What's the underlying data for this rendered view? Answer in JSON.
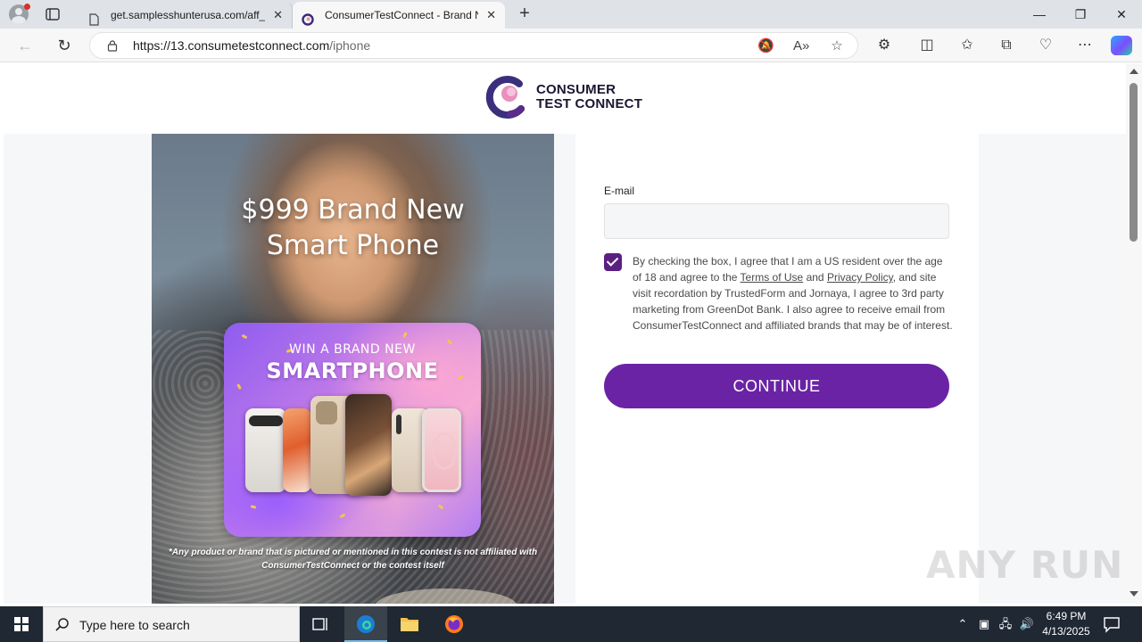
{
  "browser": {
    "tabs": [
      {
        "title": "get.samplesshunterusa.com/aff_c",
        "active": false
      },
      {
        "title": "ConsumerTestConnect - Brand N",
        "active": true
      }
    ],
    "close_glyph": "✕",
    "new_tab_glyph": "+",
    "url_host": "https://13.consumetestconnect.com",
    "url_path": "/iphone",
    "window_controls": {
      "minimize": "—",
      "restore": "❐",
      "close": "✕"
    }
  },
  "logo": {
    "line1": "CONSUMER",
    "line2": "TEST CONNECT"
  },
  "hero": {
    "title_line1": "$999 Brand New",
    "title_line2": "Smart Phone",
    "promo_line1": "WIN A BRAND NEW",
    "promo_line2": "SMARTPHONE",
    "disclaimer": "*Any product or brand that is pictured or mentioned in this contest is not affiliated with ConsumerTestConnect or the contest itself"
  },
  "form": {
    "email_label": "E-mail",
    "email_value": "",
    "checkbox_checked": true,
    "consent_part1": "By checking the box, I agree that I am a US resident over the age of 18 and agree to the ",
    "terms_link": "Terms of Use",
    "consent_and": " and ",
    "privacy_link": "Privacy Policy",
    "consent_part2": ", and site visit recordation by TrustedForm and Jornaya, I agree to 3rd party marketing from GreenDot Bank. I also agree to receive email from ConsumerTestConnect and affiliated brands that may be of interest.",
    "continue_label": "CONTINUE"
  },
  "watermark": "ANY RUN",
  "taskbar": {
    "search_placeholder": "Type here to search",
    "time": "6:49 PM",
    "date": "4/13/2025"
  },
  "colors": {
    "brand_purple": "#6a23a5",
    "checkbox_purple": "#5b1f82",
    "taskbar": "#1f2833"
  }
}
